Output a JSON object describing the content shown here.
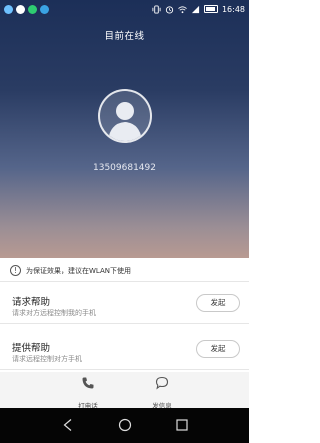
{
  "status_bar": {
    "time": "16:48",
    "left_icons": [
      "notification-icon-1",
      "notification-icon-2",
      "notification-icon-3",
      "notification-icon-4"
    ],
    "right_icons": [
      "vibrate-icon",
      "alarm-icon",
      "wifi-icon",
      "signal-icon",
      "battery-icon"
    ]
  },
  "header": {
    "title": "目前在线"
  },
  "profile": {
    "phone_number": "13509681492"
  },
  "notice": {
    "text": "为保证效果，建议在WLAN下使用"
  },
  "options": [
    {
      "title": "请求帮助",
      "subtitle": "请求对方远程控制我的手机",
      "button": "发起"
    },
    {
      "title": "提供帮助",
      "subtitle": "请求远程控制对方手机",
      "button": "发起"
    }
  ],
  "actions": {
    "call_label": "打电话",
    "sms_label": "发信息"
  },
  "colors": {
    "top_gradient_start": "#1c2f58",
    "top_gradient_end": "#b89a92",
    "navbar": "#050505"
  }
}
